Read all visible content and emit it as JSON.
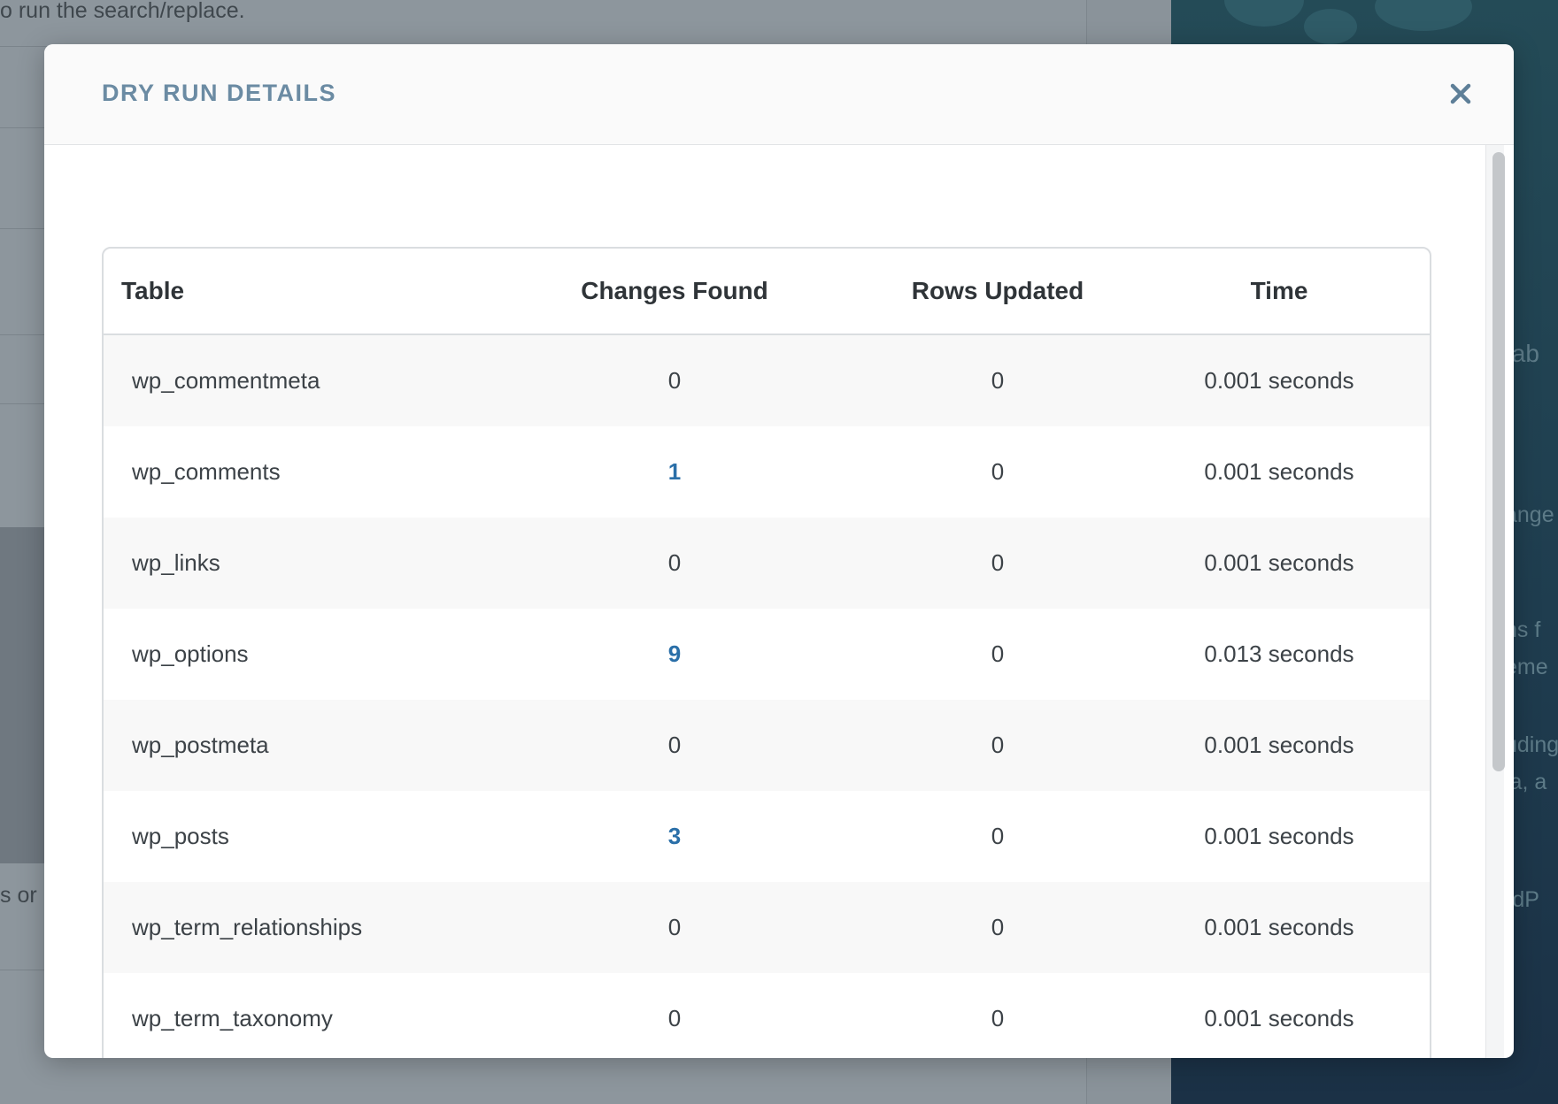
{
  "background": {
    "top_text": "o run the search/replace.",
    "left_fragment": "s or",
    "sidebar_fragments": [
      "tab",
      "ange",
      "ns f",
      "eme",
      "uding",
      "ia, a",
      "rdP"
    ]
  },
  "modal": {
    "title": "DRY RUN DETAILS",
    "close_icon": "close-icon"
  },
  "table": {
    "headers": [
      "Table",
      "Changes Found",
      "Rows Updated",
      "Time"
    ],
    "rows": [
      {
        "table": "wp_commentmeta",
        "changes": "0",
        "rows_updated": "0",
        "time": "0.001 seconds",
        "changes_link": false
      },
      {
        "table": "wp_comments",
        "changes": "1",
        "rows_updated": "0",
        "time": "0.001 seconds",
        "changes_link": true
      },
      {
        "table": "wp_links",
        "changes": "0",
        "rows_updated": "0",
        "time": "0.001 seconds",
        "changes_link": false
      },
      {
        "table": "wp_options",
        "changes": "9",
        "rows_updated": "0",
        "time": "0.013 seconds",
        "changes_link": true
      },
      {
        "table": "wp_postmeta",
        "changes": "0",
        "rows_updated": "0",
        "time": "0.001 seconds",
        "changes_link": false
      },
      {
        "table": "wp_posts",
        "changes": "3",
        "rows_updated": "0",
        "time": "0.001 seconds",
        "changes_link": true
      },
      {
        "table": "wp_term_relationships",
        "changes": "0",
        "rows_updated": "0",
        "time": "0.001 seconds",
        "changes_link": false
      },
      {
        "table": "wp_term_taxonomy",
        "changes": "0",
        "rows_updated": "0",
        "time": "0.001 seconds",
        "changes_link": false
      }
    ]
  },
  "colors": {
    "title": "#6b8ba3",
    "link": "#2a6fa8",
    "close": "#5e7f98"
  }
}
